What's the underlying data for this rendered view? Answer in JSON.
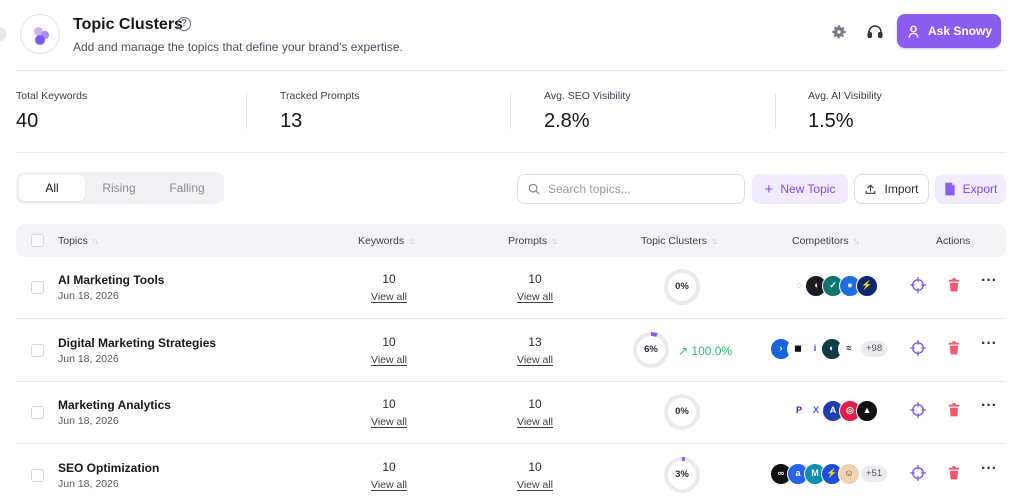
{
  "header": {
    "title": "Topic Clusters",
    "subtitle": "Add and manage the topics that define your brand's expertise.",
    "ask_label": "Ask Snowy"
  },
  "stats": [
    {
      "label": "Total Keywords",
      "value": "40"
    },
    {
      "label": "Tracked Prompts",
      "value": "13"
    },
    {
      "label": "Avg. SEO Visibility",
      "value": "2.8%"
    },
    {
      "label": "Avg. AI Visibility",
      "value": "1.5%"
    }
  ],
  "filters": {
    "all": "All",
    "rising": "Rising",
    "falling": "Falling",
    "active": "All"
  },
  "search": {
    "placeholder": "Search topics..."
  },
  "actions": {
    "new_topic": "New Topic",
    "import": "Import",
    "export": "Export"
  },
  "table": {
    "columns": {
      "topics": "Topics",
      "keywords": "Keywords",
      "prompts": "Prompts",
      "clusters": "Topic Clusters",
      "competitors": "Competitors",
      "actions": "Actions"
    },
    "view_all": "View all",
    "rows": [
      {
        "name": "AI Marketing Tools",
        "date": "Jun 18, 2026",
        "keywords": "10",
        "prompts": "10",
        "cluster_pct_label": "0%",
        "cluster_fraction": 0.0,
        "trend": "",
        "competitor_logos": [
          {
            "icon": "dotted-circle-logo",
            "color": "#ffffff",
            "fg": "#3b5bdb",
            "glyph": "◌"
          },
          {
            "icon": "black-swoosh-logo",
            "color": "#1b1b22",
            "fg": "#ffffff",
            "glyph": "◖"
          },
          {
            "icon": "check-logo",
            "color": "#0f766e",
            "fg": "#ffffff",
            "glyph": "✓"
          },
          {
            "icon": "blue-dot-logo",
            "color": "#1d6fe0",
            "fg": "#ffffff",
            "glyph": "●"
          },
          {
            "icon": "yellow-bolt-logo",
            "color": "#0c2a6b",
            "fg": "#ffd43b",
            "glyph": "⚡"
          }
        ],
        "more": ""
      },
      {
        "name": "Digital Marketing Strategies",
        "date": "Jun 18, 2026",
        "keywords": "10",
        "prompts": "13",
        "cluster_pct_label": "6%",
        "cluster_fraction": 0.06,
        "trend": "100.0%",
        "competitor_logos": [
          {
            "icon": "blue-chevron-logo",
            "color": "#1565d8",
            "fg": "#ffffff",
            "glyph": "›"
          },
          {
            "icon": "black-flag-logo",
            "color": "#ffffff",
            "fg": "#111111",
            "glyph": "◼"
          },
          {
            "icon": "info-logo",
            "color": "#ffffff",
            "fg": "#1d4ed8",
            "glyph": "i"
          },
          {
            "icon": "teal-circle-logo",
            "color": "#0e3b4a",
            "fg": "#ffffff",
            "glyph": "◐"
          },
          {
            "icon": "swirl-logo",
            "color": "#ffffff",
            "fg": "#111111",
            "glyph": "≈"
          }
        ],
        "more": "+98"
      },
      {
        "name": "Marketing Analytics",
        "date": "Jun 18, 2026",
        "keywords": "10",
        "prompts": "10",
        "cluster_pct_label": "0%",
        "cluster_fraction": 0.0,
        "trend": "",
        "competitor_logos": [
          {
            "icon": "p-logo",
            "color": "#ffffff",
            "fg": "#4c1d95",
            "glyph": "P"
          },
          {
            "icon": "x-logo",
            "color": "#ffffff",
            "fg": "#2563eb",
            "glyph": "X"
          },
          {
            "icon": "a-logo",
            "color": "#1e40af",
            "fg": "#ffffff",
            "glyph": "A"
          },
          {
            "icon": "red-target-logo",
            "color": "#e11d48",
            "fg": "#ffffff",
            "glyph": "◎"
          },
          {
            "icon": "mountain-logo",
            "color": "#111111",
            "fg": "#ffffff",
            "glyph": "▲"
          }
        ],
        "more": ""
      },
      {
        "name": "SEO Optimization",
        "date": "Jun 18, 2026",
        "keywords": "10",
        "prompts": "10",
        "cluster_pct_label": "3%",
        "cluster_fraction": 0.03,
        "trend": "",
        "competitor_logos": [
          {
            "icon": "black-dots-logo",
            "color": "#111111",
            "fg": "#ffffff",
            "glyph": "∞"
          },
          {
            "icon": "blue-a-logo",
            "color": "#2563eb",
            "fg": "#ffffff",
            "glyph": "a"
          },
          {
            "icon": "cyan-m-logo",
            "color": "#0891b2",
            "fg": "#ffffff",
            "glyph": "M"
          },
          {
            "icon": "blue-bolt-logo",
            "color": "#1d4ed8",
            "fg": "#ffffff",
            "glyph": "⚡"
          },
          {
            "icon": "face-logo",
            "color": "#f3d2b3",
            "fg": "#333333",
            "glyph": "☺"
          }
        ],
        "more": "+51"
      }
    ]
  },
  "colors": {
    "accent": "#8a5cf0",
    "trend_up": "#2fbf71",
    "delete": "#f05a6e",
    "target": "#7c5ce6"
  }
}
